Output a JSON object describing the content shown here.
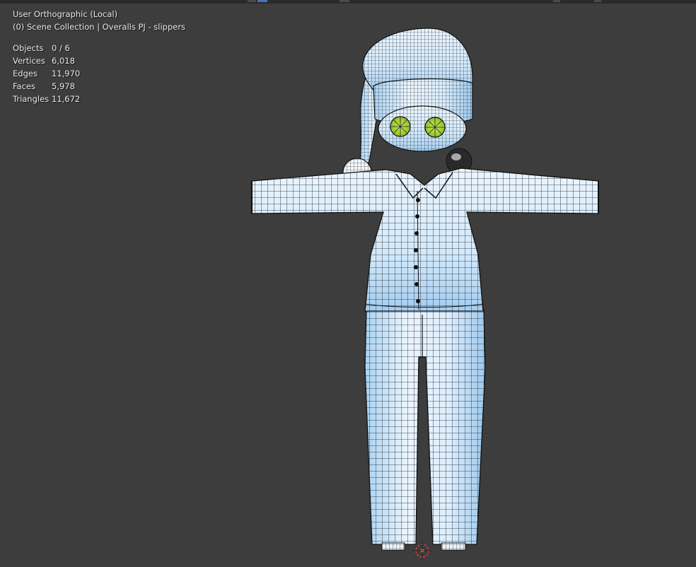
{
  "viewport": {
    "view_name": "User Orthographic (Local)",
    "collection_line": "(0) Scene Collection | Overalls  PJ  - slippers"
  },
  "stats": [
    {
      "label": "Objects",
      "value": "0 / 6"
    },
    {
      "label": "Vertices",
      "value": "6,018"
    },
    {
      "label": "Edges",
      "value": "11,970"
    },
    {
      "label": "Faces",
      "value": "5,978"
    },
    {
      "label": "Triangles",
      "value": "11,672"
    }
  ],
  "colors": {
    "background": "#3d3d3d",
    "mesh_fill": "#dceeff",
    "mesh_shadow": "#9cc8ec",
    "wire": "#1a1a1a",
    "eye": "#a6d23a",
    "origin": "#e03a3a"
  }
}
